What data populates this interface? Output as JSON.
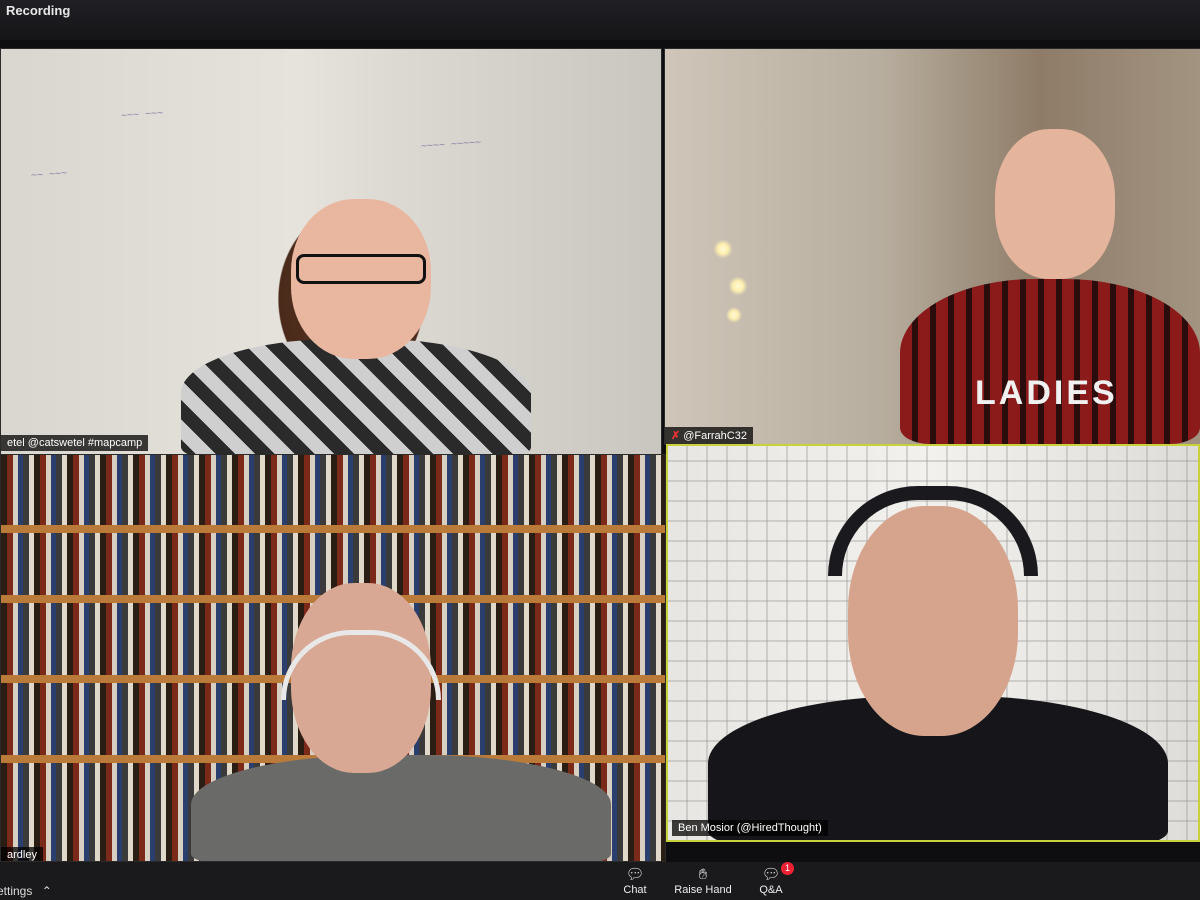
{
  "app": {
    "recording_label": "Recording",
    "accent_color": "#c9d13a",
    "muted_color": "#e23333"
  },
  "participants": [
    {
      "name": "etel @catswetel #mapcamp",
      "muted": false,
      "speaking": false
    },
    {
      "name": "@FarrahC32",
      "muted": true,
      "speaking": false
    },
    {
      "name": "ardley",
      "muted": false,
      "speaking": false
    },
    {
      "name": "Ben Mosior (@HiredThought)",
      "muted": false,
      "speaking": true
    }
  ],
  "controls": {
    "settings_label": "ettings",
    "chat_label": "Chat",
    "raise_hand_label": "Raise Hand",
    "qa_label": "Q&A",
    "qa_badge": "1"
  },
  "icons": {
    "chat": "chat-bubble-icon",
    "raise_hand": "hand-icon",
    "qa": "qa-bubble-icon",
    "muted_mic": "muted-mic-icon",
    "settings_caret": "chevron-up-icon"
  }
}
